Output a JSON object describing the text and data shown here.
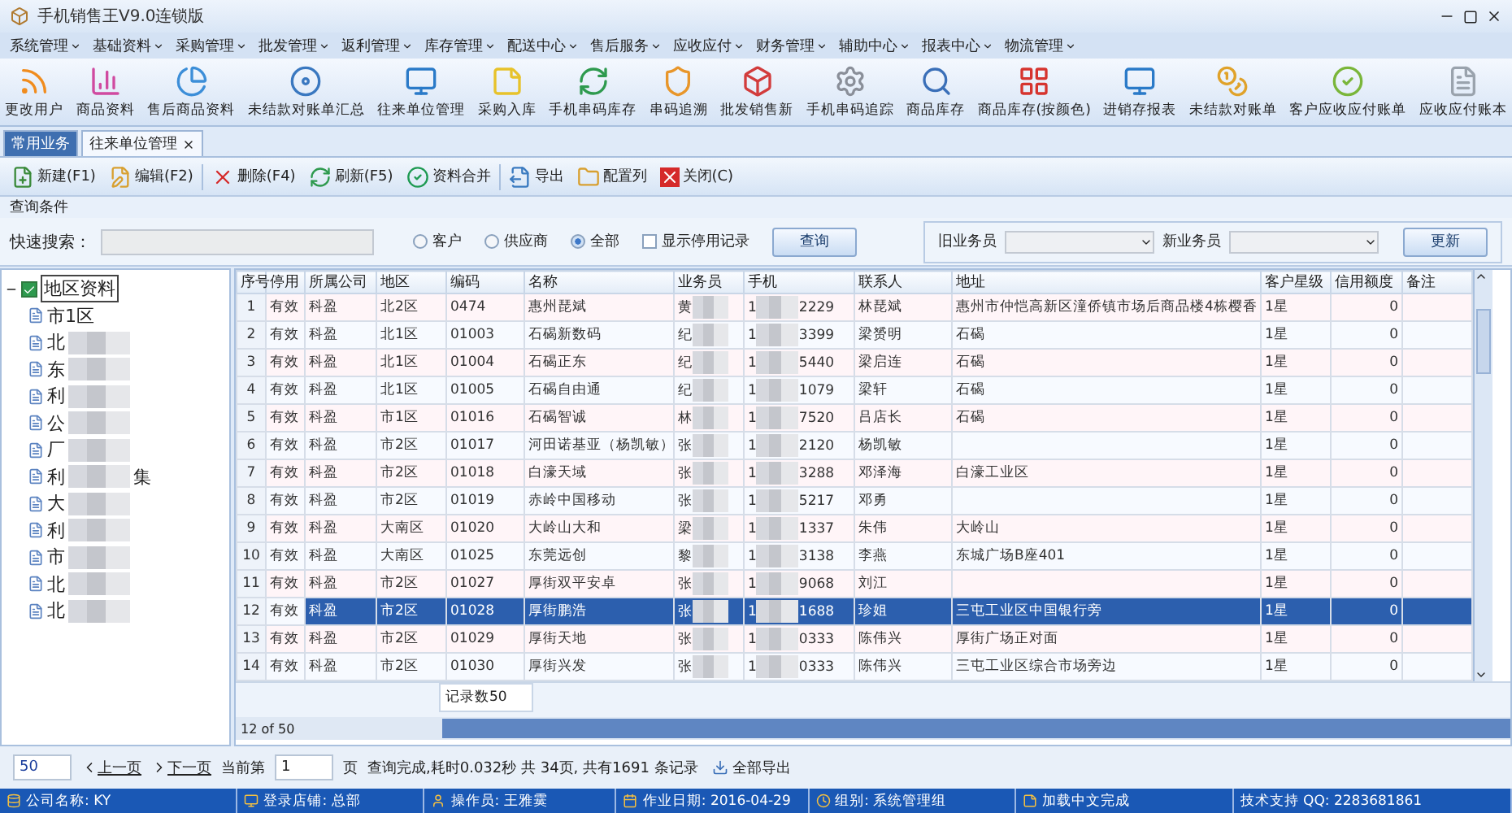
{
  "window": {
    "title": "手机销售王V9.0连锁版"
  },
  "menu": [
    {
      "label": "系统管理"
    },
    {
      "label": "基础资料"
    },
    {
      "label": "采购管理"
    },
    {
      "label": "批发管理"
    },
    {
      "label": "返利管理"
    },
    {
      "label": "库存管理"
    },
    {
      "label": "配送中心"
    },
    {
      "label": "售后服务"
    },
    {
      "label": "应收应付"
    },
    {
      "label": "财务管理"
    },
    {
      "label": "辅助中心"
    },
    {
      "label": "报表中心"
    },
    {
      "label": "物流管理"
    }
  ],
  "quick_toolbar": [
    {
      "label": "更改用户",
      "kind": "rss"
    },
    {
      "label": "商品资料",
      "kind": "bars"
    },
    {
      "label": "售后商品资料",
      "kind": "pie"
    },
    {
      "label": "未结款对账单汇总",
      "kind": "disc"
    },
    {
      "label": "往来单位管理",
      "kind": "monitor"
    },
    {
      "label": "采购入库",
      "kind": "note"
    },
    {
      "label": "手机串码库存",
      "kind": "refresh"
    },
    {
      "label": "串码追溯",
      "kind": "shield"
    },
    {
      "label": "批发销售新",
      "kind": "cube"
    },
    {
      "label": "手机串码追踪",
      "kind": "gear"
    },
    {
      "label": "商品库存",
      "kind": "search"
    },
    {
      "label": "商品库存(按颜色)",
      "kind": "blocks"
    },
    {
      "label": "进销存报表",
      "kind": "monitor"
    },
    {
      "label": "未结款对账单",
      "kind": "coin"
    },
    {
      "label": "客户应收应付账单",
      "kind": "check"
    },
    {
      "label": "应收应付账本",
      "kind": "doc"
    }
  ],
  "tabs": [
    {
      "label": "常用业务",
      "selected": false,
      "closable": false
    },
    {
      "label": "往来单位管理",
      "selected": true,
      "closable": true
    }
  ],
  "actions": [
    {
      "label": "新建(F1)",
      "kind": "new"
    },
    {
      "label": "编辑(F2)",
      "kind": "edit"
    },
    {
      "label": "删除(F4)",
      "kind": "delete"
    },
    {
      "label": "刷新(F5)",
      "kind": "refresh"
    },
    {
      "label": "资料合并",
      "kind": "merge"
    },
    {
      "label": "导出",
      "kind": "export"
    },
    {
      "label": "配置列",
      "kind": "folder"
    },
    {
      "label": "关闭(C)",
      "kind": "close"
    }
  ],
  "query": {
    "title": "查询条件",
    "search_label": "快速搜索：",
    "types": [
      {
        "label": "客户",
        "selected": false
      },
      {
        "label": "供应商",
        "selected": false
      },
      {
        "label": "全部",
        "selected": true
      }
    ],
    "show_disabled": {
      "label": "显示停用记录",
      "checked": false
    },
    "query_button": "查询",
    "old_rep_label": "旧业务员",
    "new_rep_label": "新业务员",
    "update_button": "更新"
  },
  "tree": {
    "label": "地区资料",
    "checked": true,
    "expanded": true,
    "selected": true,
    "children": [
      {
        "head": "市1区"
      },
      {
        "head": "北"
      },
      {
        "head": "东"
      },
      {
        "head": "利"
      },
      {
        "head": "公"
      },
      {
        "head": "厂"
      },
      {
        "head": "利",
        "tail": "集"
      },
      {
        "head": "大"
      },
      {
        "head": "利"
      },
      {
        "head": "市"
      },
      {
        "head": "北"
      },
      {
        "head": "北"
      }
    ]
  },
  "table": {
    "columns": [
      "序号",
      "停用",
      "所属公司",
      "地区",
      "编码",
      "名称",
      "业务员",
      "手机",
      "联系人",
      "地址",
      "客户星级",
      "信用额度",
      "备注"
    ],
    "rows": [
      {
        "no": "1",
        "status": "有效",
        "company": "科盈",
        "area": "北2区",
        "code": "0474",
        "name": "惠州琵斌",
        "rep": "黄",
        "phone_head": "1",
        "phone_tail": "2229",
        "contact": "林琵斌",
        "address": "惠州市仲恺高新区潼侨镇市场后商品楼4栋樱香",
        "star": "1星",
        "credit": "0",
        "selected": false
      },
      {
        "no": "2",
        "status": "有效",
        "company": "科盈",
        "area": "北1区",
        "code": "01003",
        "name": "石碣新数码",
        "rep": "纪",
        "phone_head": "1",
        "phone_tail": "3399",
        "contact": "梁赟明",
        "address": "石碣",
        "star": "1星",
        "credit": "0",
        "selected": false
      },
      {
        "no": "3",
        "status": "有效",
        "company": "科盈",
        "area": "北1区",
        "code": "01004",
        "name": "石碣正东",
        "rep": "纪",
        "phone_head": "1",
        "phone_tail": "5440",
        "contact": "梁启连",
        "address": "石碣",
        "star": "1星",
        "credit": "0",
        "selected": false
      },
      {
        "no": "4",
        "status": "有效",
        "company": "科盈",
        "area": "北1区",
        "code": "01005",
        "name": "石碣自由通",
        "rep": "纪",
        "phone_head": "1",
        "phone_tail": "1079",
        "contact": "梁轩",
        "address": "石碣",
        "star": "1星",
        "credit": "0",
        "selected": false
      },
      {
        "no": "5",
        "status": "有效",
        "company": "科盈",
        "area": "市1区",
        "code": "01016",
        "name": "石碣智诚",
        "rep": "林",
        "phone_head": "1",
        "phone_tail": "7520",
        "contact": "吕店长",
        "address": "石碣",
        "star": "1星",
        "credit": "0",
        "selected": false
      },
      {
        "no": "6",
        "status": "有效",
        "company": "科盈",
        "area": "市2区",
        "code": "01017",
        "name": "河田诺基亚（杨凯敏）",
        "rep": "张",
        "phone_head": "1",
        "phone_tail": "2120",
        "contact": "杨凯敏",
        "address": "",
        "star": "1星",
        "credit": "0",
        "selected": false
      },
      {
        "no": "7",
        "status": "有效",
        "company": "科盈",
        "area": "市2区",
        "code": "01018",
        "name": "白濠天域",
        "rep": "张",
        "phone_head": "1",
        "phone_tail": "3288",
        "contact": "邓泽海",
        "address": "白濠工业区",
        "star": "1星",
        "credit": "0",
        "selected": false
      },
      {
        "no": "8",
        "status": "有效",
        "company": "科盈",
        "area": "市2区",
        "code": "01019",
        "name": "赤岭中国移动",
        "rep": "张",
        "phone_head": "1",
        "phone_tail": "5217",
        "contact": "邓勇",
        "address": "",
        "star": "1星",
        "credit": "0",
        "selected": false
      },
      {
        "no": "9",
        "status": "有效",
        "company": "科盈",
        "area": "大南区",
        "code": "01020",
        "name": "大岭山大和",
        "rep": "梁",
        "phone_head": "1",
        "phone_tail": "1337",
        "contact": "朱伟",
        "address": "大岭山",
        "star": "1星",
        "credit": "0",
        "selected": false
      },
      {
        "no": "10",
        "status": "有效",
        "company": "科盈",
        "area": "大南区",
        "code": "01025",
        "name": "东莞远创",
        "rep": "黎",
        "phone_head": "1",
        "phone_tail": "3138",
        "contact": "李燕",
        "address": "东城广场B座401",
        "star": "1星",
        "credit": "0",
        "selected": false
      },
      {
        "no": "11",
        "status": "有效",
        "company": "科盈",
        "area": "市2区",
        "code": "01027",
        "name": "厚街双平安卓",
        "rep": "张",
        "phone_head": "1",
        "phone_tail": "9068",
        "contact": "刘江",
        "address": "",
        "star": "1星",
        "credit": "0",
        "selected": false
      },
      {
        "no": "12",
        "status": "有效",
        "company": "科盈",
        "area": "市2区",
        "code": "01028",
        "name": "厚街鹏浩",
        "rep": "张",
        "phone_head": "1",
        "phone_tail": "1688",
        "contact": "珍姐",
        "address": "三屯工业区中国银行旁",
        "star": "1星",
        "credit": "0",
        "selected": true
      },
      {
        "no": "13",
        "status": "有效",
        "company": "科盈",
        "area": "市2区",
        "code": "01029",
        "name": "厚街天地",
        "rep": "张",
        "phone_head": "1",
        "phone_tail": "0333",
        "contact": "陈伟兴",
        "address": "厚街广场正对面",
        "star": "1星",
        "credit": "0",
        "selected": false
      },
      {
        "no": "14",
        "status": "有效",
        "company": "科盈",
        "area": "市2区",
        "code": "01030",
        "name": "厚街兴发",
        "rep": "张",
        "phone_head": "1",
        "phone_tail": "0333",
        "contact": "陈伟兴",
        "address": "三屯工业区综合市场旁边",
        "star": "1星",
        "credit": "0",
        "selected": false
      }
    ],
    "record_count": "记录数50",
    "navigator": "12 of 50"
  },
  "pager": {
    "page_size": "50",
    "prev": "上一页",
    "next": "下一页",
    "current_label": "当前第",
    "current": "1",
    "page_unit": "页",
    "summary": "查询完成,耗时0.032秒 共 34页, 共有1691 条记录",
    "export_all": "全部导出"
  },
  "status_bar": [
    {
      "text": "公司名称: KY",
      "kind": "db"
    },
    {
      "text": "登录店铺: 总部",
      "kind": "pc"
    },
    {
      "text": "操作员: 王雅霙",
      "kind": "user"
    },
    {
      "text": "作业日期: 2016-04-29",
      "kind": "calendar"
    },
    {
      "text": "组别: 系统管理组",
      "kind": "clock"
    },
    {
      "text": "加载中文完成",
      "kind": "note"
    },
    {
      "text": "技术支持 QQ: 2283681861",
      "kind": "none"
    }
  ]
}
